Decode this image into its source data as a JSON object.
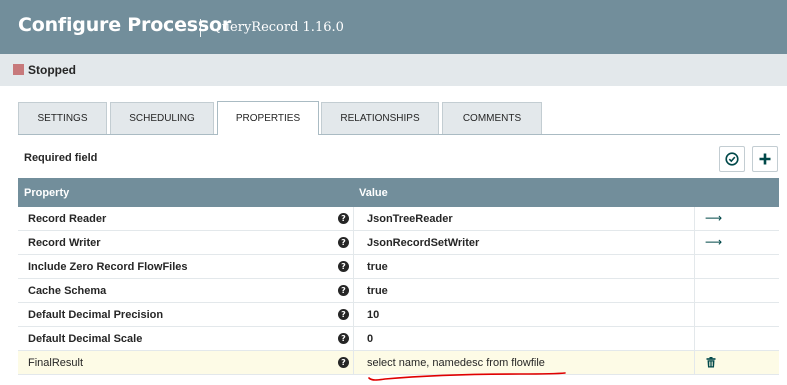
{
  "header": {
    "title": "Configure Processor",
    "subtitle": "QueryRecord 1.16.0"
  },
  "status": {
    "text": "Stopped",
    "color": "#c7797b"
  },
  "tabs": [
    {
      "label": "SETTINGS",
      "active": false
    },
    {
      "label": "SCHEDULING",
      "active": false
    },
    {
      "label": "PROPERTIES",
      "active": true
    },
    {
      "label": "RELATIONSHIPS",
      "active": false
    },
    {
      "label": "COMMENTS",
      "active": false
    }
  ],
  "required_field_label": "Required field",
  "toolbar": {
    "verify_icon": "check-circle-icon",
    "add_icon": "plus-icon"
  },
  "table": {
    "columns": [
      "Property",
      "Value"
    ],
    "rows": [
      {
        "name": "Record Reader",
        "value": "JsonTreeReader",
        "action": "arrow-right-icon"
      },
      {
        "name": "Record Writer",
        "value": "JsonRecordSetWriter",
        "action": "arrow-right-icon"
      },
      {
        "name": "Include Zero Record FlowFiles",
        "value": "true",
        "action": ""
      },
      {
        "name": "Cache Schema",
        "value": "true",
        "action": ""
      },
      {
        "name": "Default Decimal Precision",
        "value": "10",
        "action": ""
      },
      {
        "name": "Default Decimal Scale",
        "value": "0",
        "action": ""
      },
      {
        "name": "FinalResult",
        "value": "select name, namedesc from flowfile",
        "action": "trash-icon"
      }
    ]
  },
  "colors": {
    "header_bg": "#728e9b",
    "status_bg": "#e3e8eb",
    "accent": "#004849",
    "annotation": "#e00000"
  }
}
